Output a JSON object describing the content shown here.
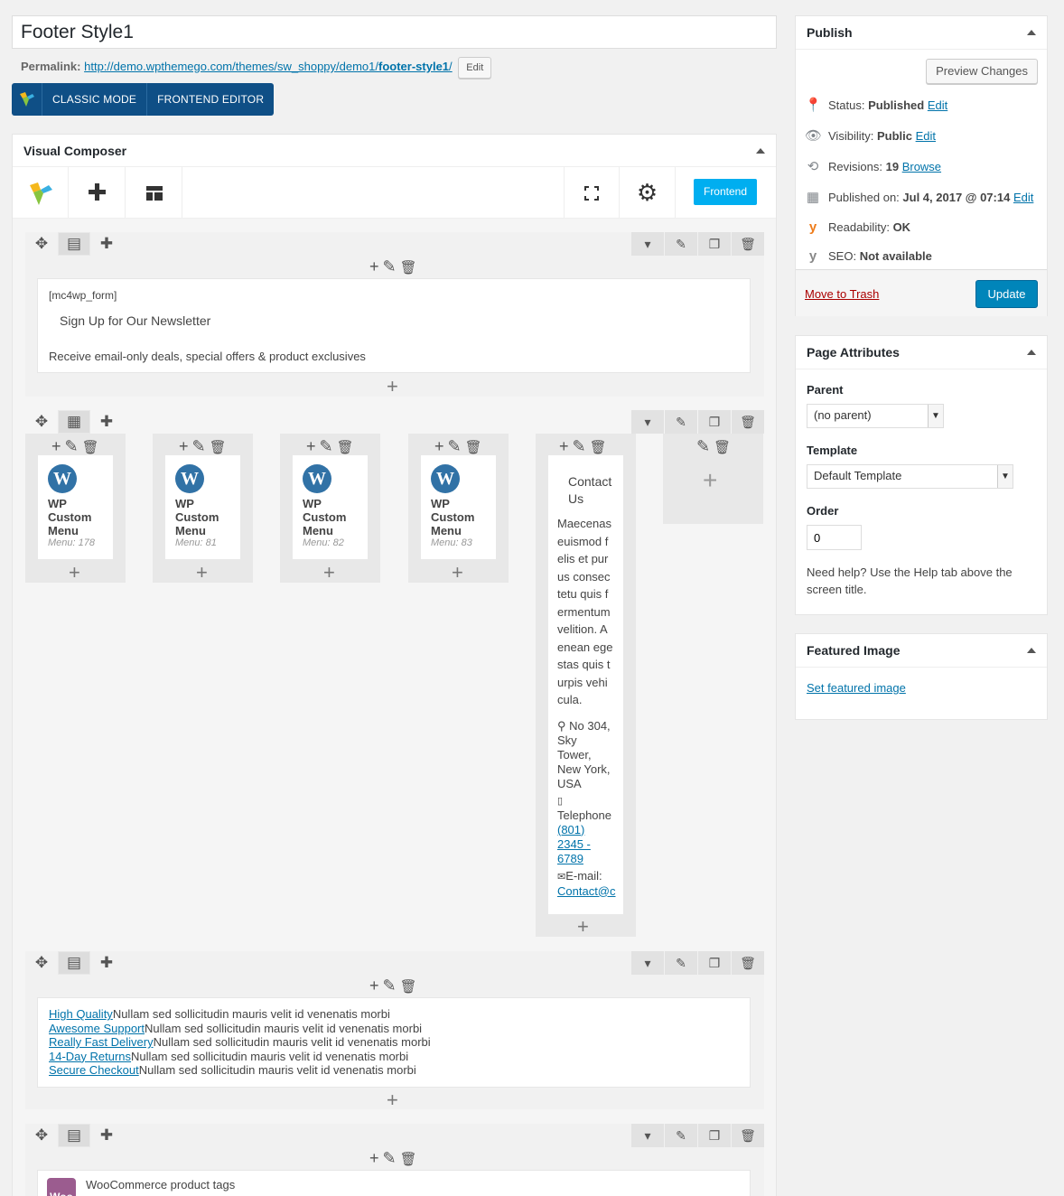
{
  "title": {
    "value": "Footer Style1"
  },
  "permalink": {
    "label": "Permalink:",
    "url_base": "http://demo.wpthemego.com/themes/sw_shoppy/demo1/",
    "url_slug": "footer-style1",
    "url_end": "/",
    "edit_label": "Edit"
  },
  "vc_modes": {
    "classic": "CLASSIC MODE",
    "frontend": "FRONTEND EDITOR"
  },
  "vc": {
    "title": "Visual Composer",
    "frontend_button": "Frontend",
    "row1": {
      "shortcode": "[mc4wp_form]",
      "heading": "Sign Up for Our Newsletter",
      "subtext": "Receive email-only deals, special offers & product exclusives"
    },
    "row2": {
      "menus": [
        {
          "title": "WP Custom Menu",
          "meta": "Menu: 178"
        },
        {
          "title": "WP Custom Menu",
          "meta": "Menu: 81"
        },
        {
          "title": "WP Custom Menu",
          "meta": "Menu: 82"
        },
        {
          "title": "WP Custom Menu",
          "meta": "Menu: 83"
        }
      ],
      "contact": {
        "heading": "Contact Us",
        "body": "Maecenas euismod felis et purus consectetu quis fermentum velition. Aenean egestas quis turpis vehicula.",
        "address": "No 304, Sky Tower, New York, USA",
        "phone_label": "Telephone",
        "phone": "(801) 2345 - 6789",
        "email_label": "E-mail:",
        "email": "Contact@c"
      }
    },
    "row3": {
      "items": [
        {
          "link": "High Quality",
          "text": "Nullam sed sollicitudin mauris velit id venenatis morbi"
        },
        {
          "link": "Awesome Support",
          "text": "Nullam sed sollicitudin mauris velit id venenatis morbi"
        },
        {
          "link": "Really Fast Delivery",
          "text": "Nullam sed sollicitudin mauris velit id venenatis morbi"
        },
        {
          "link": "14-Day Returns",
          "text": "Nullam sed sollicitudin mauris velit id venenatis morbi"
        },
        {
          "link": "Secure Checkout",
          "text": "Nullam sed sollicitudin mauris velit id venenatis morbi"
        }
      ]
    },
    "row4": {
      "element": "WooCommerce product tags",
      "badge": "Woo"
    }
  },
  "publish": {
    "title": "Publish",
    "preview": "Preview Changes",
    "status_label": "Status:",
    "status_value": "Published",
    "status_edit": "Edit",
    "visibility_label": "Visibility:",
    "visibility_value": "Public",
    "visibility_edit": "Edit",
    "revisions_label": "Revisions:",
    "revisions_value": "19",
    "revisions_link": "Browse",
    "published_label": "Published on:",
    "published_value": "Jul 4, 2017 @ 07:14",
    "published_edit": "Edit",
    "readability_label": "Readability:",
    "readability_value": "OK",
    "seo_label": "SEO:",
    "seo_value": "Not available",
    "trash": "Move to Trash",
    "update": "Update"
  },
  "attributes": {
    "title": "Page Attributes",
    "parent_label": "Parent",
    "parent_value": "(no parent)",
    "template_label": "Template",
    "template_value": "Default Template",
    "order_label": "Order",
    "order_value": "0",
    "help": "Need help? Use the Help tab above the screen title."
  },
  "featured": {
    "title": "Featured Image",
    "link": "Set featured image"
  }
}
